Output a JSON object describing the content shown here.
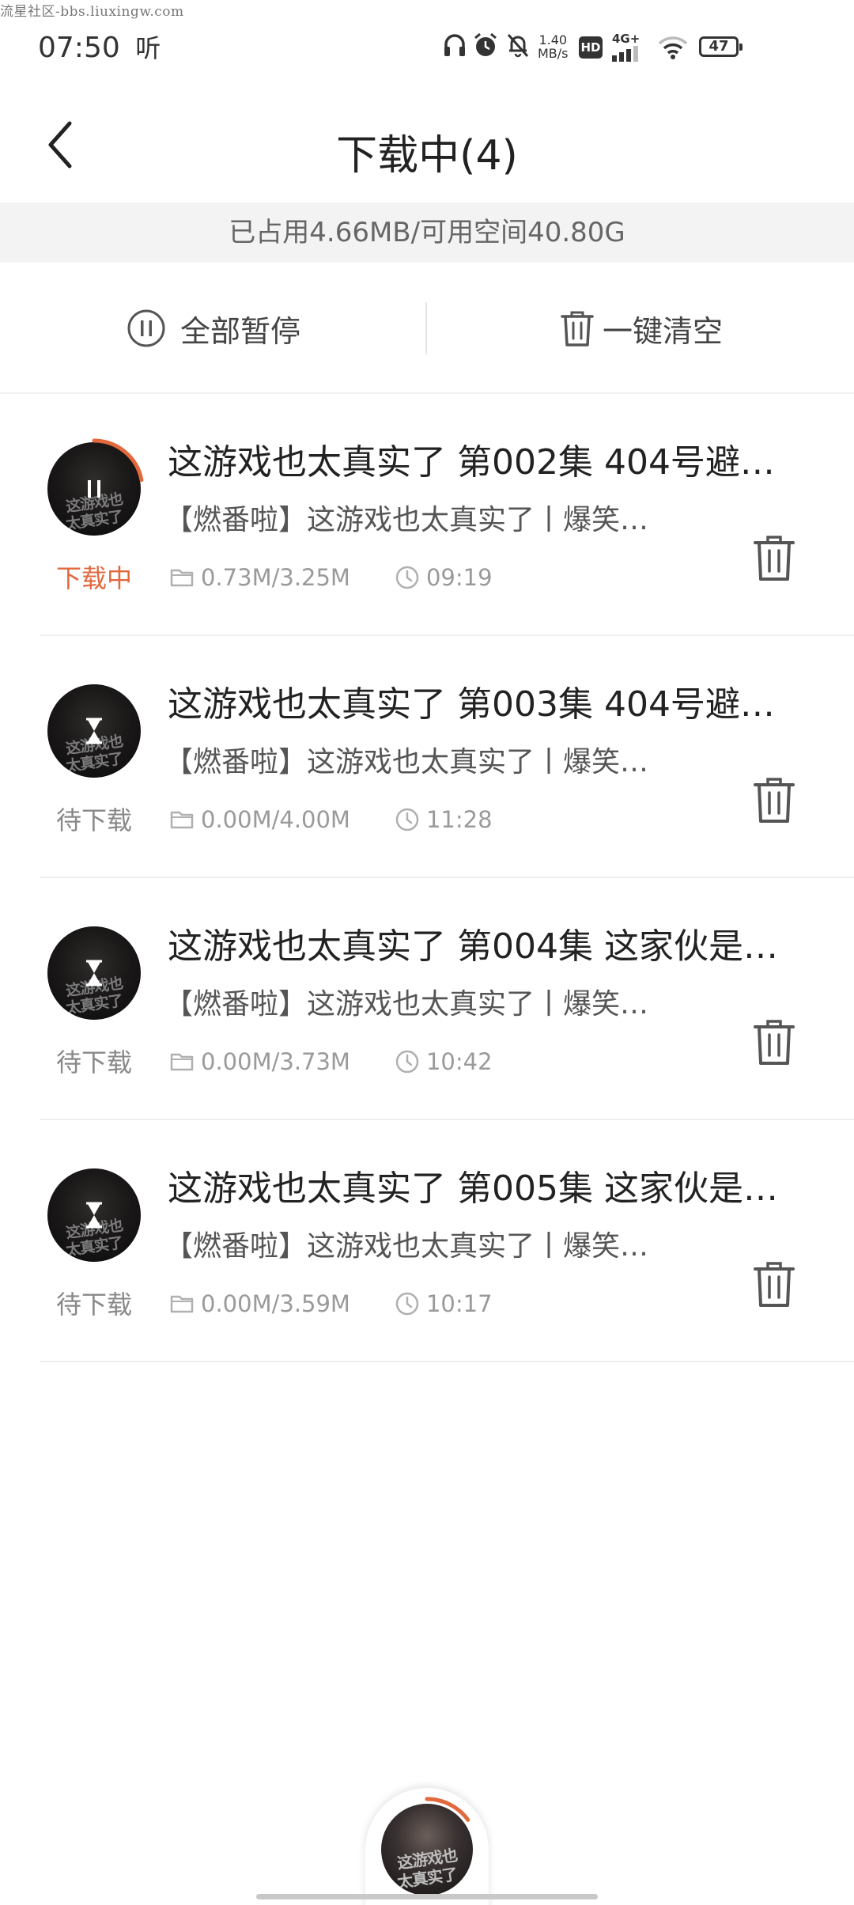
{
  "watermark": "流星社区-bbs.liuxingw.com",
  "status_bar": {
    "time": "07:50",
    "speed_value": "1.40",
    "speed_unit": "MB/s",
    "network_hd": "HD",
    "network_type": "4G+",
    "battery": "47"
  },
  "header": {
    "title": "下载中(4)"
  },
  "storage": {
    "text": "已占用4.66MB/可用空间40.80G"
  },
  "actions": {
    "pause_all": "全部暂停",
    "clear_all": "一键清空"
  },
  "downloads": [
    {
      "title": "这游戏也太真实了 第002集 404号避…",
      "subtitle": "【燃番啦】这游戏也太真实了丨爆笑…",
      "status": "下载中",
      "size": "0.73M/3.25M",
      "duration": "09:19",
      "progress": 0.22,
      "state": "downloading"
    },
    {
      "title": "这游戏也太真实了 第003集 404号避…",
      "subtitle": "【燃番啦】这游戏也太真实了丨爆笑…",
      "status": "待下载",
      "size": "0.00M/4.00M",
      "duration": "11:28",
      "progress": 0,
      "state": "waiting"
    },
    {
      "title": "这游戏也太真实了 第004集 这家伙是…",
      "subtitle": "【燃番啦】这游戏也太真实了丨爆笑…",
      "status": "待下载",
      "size": "0.00M/3.73M",
      "duration": "10:42",
      "progress": 0,
      "state": "waiting"
    },
    {
      "title": "这游戏也太真实了 第005集 这家伙是…",
      "subtitle": "【燃番啦】这游戏也太真实了丨爆笑…",
      "status": "待下载",
      "size": "0.00M/3.59M",
      "duration": "10:17",
      "progress": 0,
      "state": "waiting"
    }
  ],
  "thumbnail_text": [
    "这游戏也",
    "太真实了"
  ],
  "colors": {
    "accent": "#e2683d",
    "muted": "#9a9a9a",
    "storage_bg": "#f3f3f3"
  },
  "mini_player": {
    "progress": 0.15
  }
}
